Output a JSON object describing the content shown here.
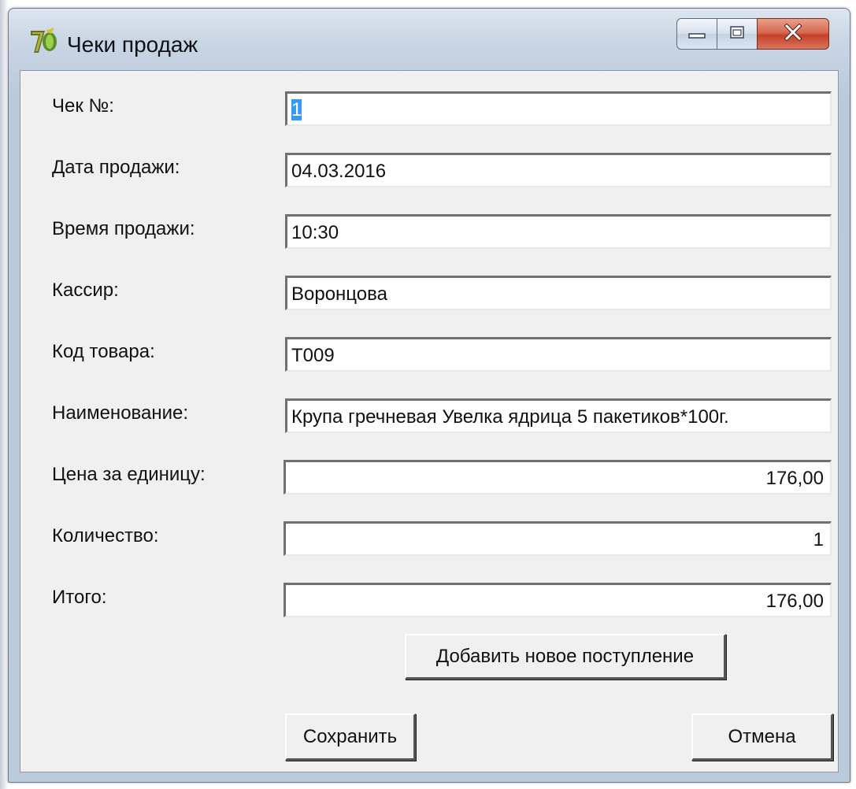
{
  "window": {
    "title": "Чеки продаж",
    "controls": {
      "minimize": "minimize",
      "maximize": "maximize",
      "close": "close"
    }
  },
  "form": {
    "fields": [
      {
        "label": "Чек №:",
        "value": "1",
        "selected": true,
        "align": "left"
      },
      {
        "label": "Дата продажи:",
        "value": "04.03.2016",
        "align": "left"
      },
      {
        "label": "Время продажи:",
        "value": "10:30",
        "align": "left"
      },
      {
        "label": "Кассир:",
        "value": "Воронцова",
        "align": "left"
      },
      {
        "label": "Код товара:",
        "value": "Т009",
        "align": "left"
      },
      {
        "label": "Наименование:",
        "value": "Крупа гречневая Увелка ядрица 5 пакетиков*100г.",
        "align": "left"
      },
      {
        "label": "Цена за единицу:",
        "value": "176,00",
        "align": "right"
      },
      {
        "label": "Количество:",
        "value": "1",
        "align": "right"
      },
      {
        "label": "Итого:",
        "value": "176,00",
        "align": "right"
      }
    ]
  },
  "buttons": {
    "add": "Добавить новое поступление",
    "save": "Сохранить",
    "cancel": "Отмена"
  },
  "colors": {
    "selection": "#3399ff",
    "close_button": "#c4402a"
  },
  "icons": {
    "app": "delphi-app-icon",
    "minimize": "minimize-icon",
    "maximize": "maximize-icon",
    "close": "close-icon"
  }
}
